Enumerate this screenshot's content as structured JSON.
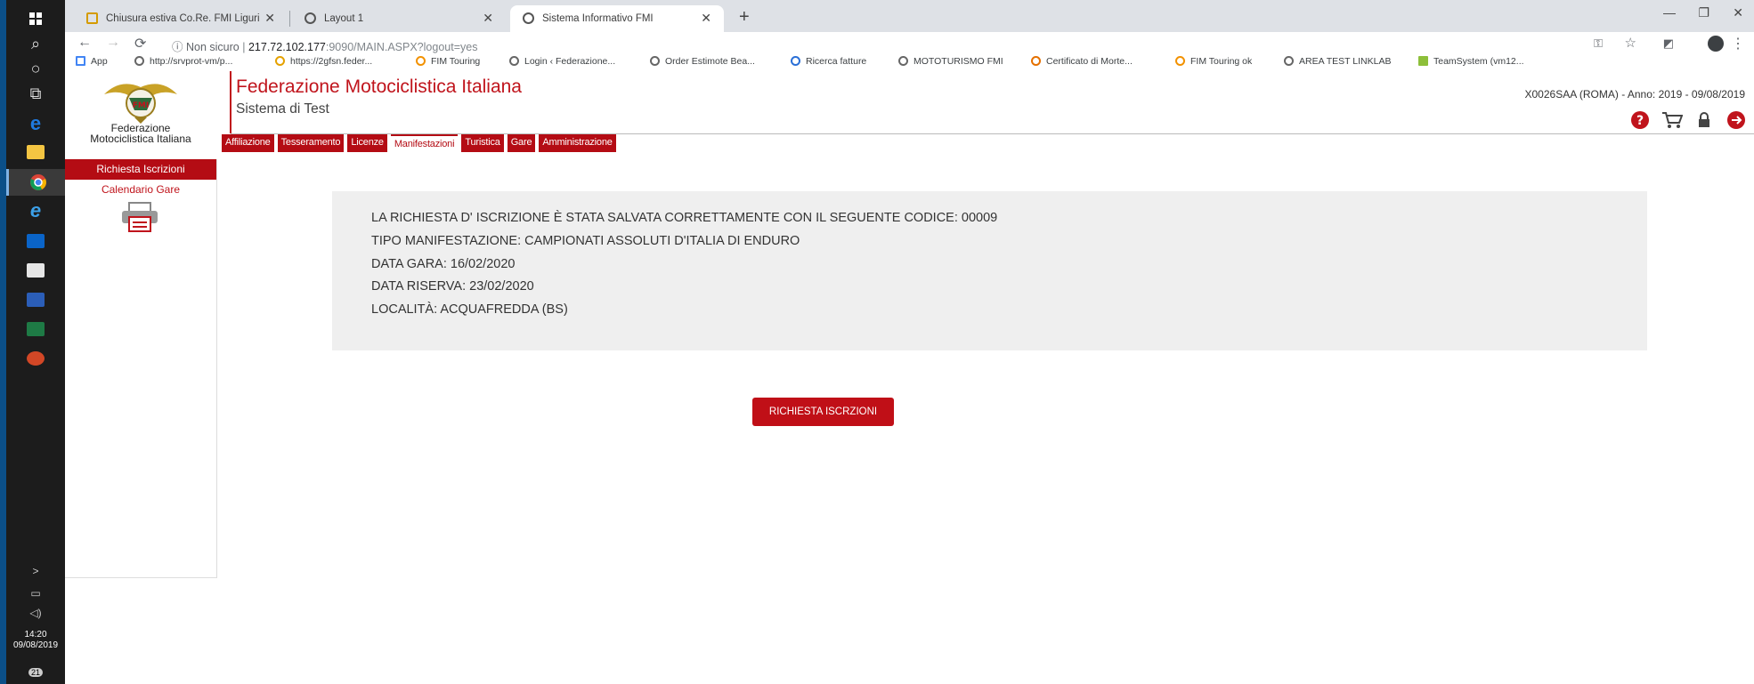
{
  "taskbar": {
    "time": "14:20",
    "date": "09/08/2019",
    "notif": "21"
  },
  "tabs": [
    {
      "title": "Chiusura estiva Co.Re. FMI Liguri"
    },
    {
      "title": "Layout 1"
    },
    {
      "title": "Sistema Informativo FMI"
    }
  ],
  "address": {
    "security": "Non sicuro",
    "host": "217.72.102.177",
    "path": ":9090/MAIN.ASPX?logout=yes"
  },
  "bookmarks": [
    "App",
    "http://srvprot-vm/p...",
    "https://2gfsn.feder...",
    "FIM Touring",
    "Login ‹ Federazione...",
    "Order Estimote Bea...",
    "Ricerca fatture",
    "MOTOTURISMO FMI",
    "Certificato di Morte...",
    "FIM Touring ok",
    "AREA TEST LINKLAB",
    "TeamSystem (vm12..."
  ],
  "header": {
    "title": "Federazione Motociclistica Italiana",
    "subtitle": "Sistema di Test",
    "logo_text": "Federazione Motociclistica Italiana",
    "user_info": "X0026SAA (ROMA) - Anno: 2019 - 09/08/2019"
  },
  "menu": [
    "Affiliazione",
    "Tesseramento",
    "Licenze",
    "Manifestazioni",
    "Turistica",
    "Gare",
    "Amministrazione"
  ],
  "sidebar": [
    "Richiesta Iscrizioni",
    "Calendario Gare"
  ],
  "message": {
    "line1": "LA RICHIESTA D' ISCRIZIONE È STATA SALVATA CORRETTAMENTE CON IL SEGUENTE CODICE: 00009",
    "line2": "TIPO MANIFESTAZIONE: CAMPIONATI ASSOLUTI D'ITALIA DI ENDURO",
    "line3": "DATA GARA: 16/02/2020",
    "line4": "DATA RISERVA: 23/02/2020",
    "line5": "LOCALITÀ: ACQUAFREDDA (BS)"
  },
  "button": "RICHIESTA ISCRZIONI",
  "colors": {
    "brand_red": "#c0141c",
    "panel": "#efefef"
  }
}
